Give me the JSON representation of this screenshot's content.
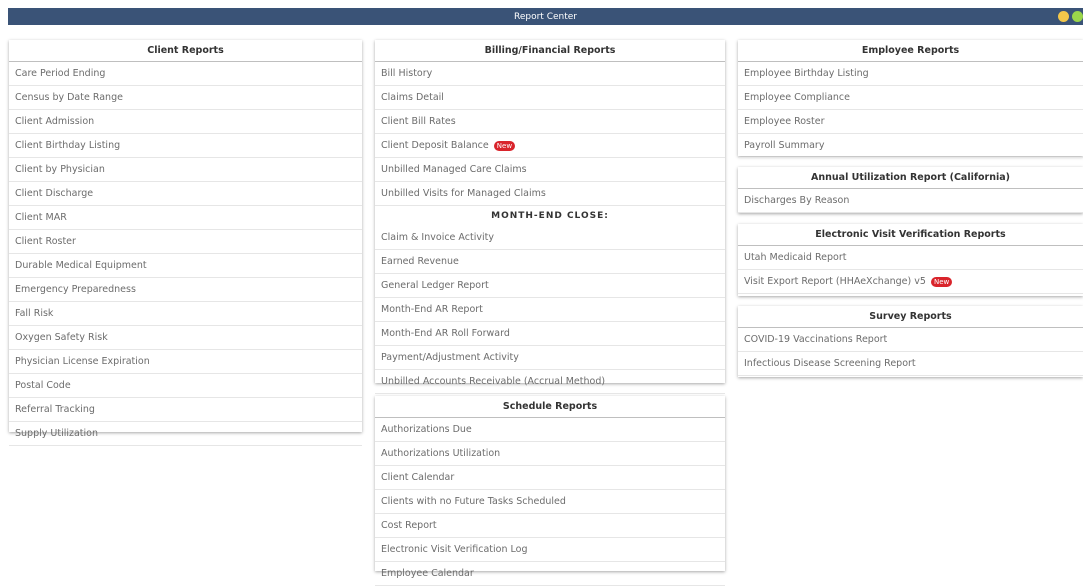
{
  "window": {
    "title": "Report Center"
  },
  "client_reports": {
    "title": "Client Reports",
    "items": [
      "Care Period Ending",
      "Census by Date Range",
      "Client Admission",
      "Client Birthday Listing",
      "Client by Physician",
      "Client Discharge",
      "Client MAR",
      "Client Roster",
      "Durable Medical Equipment",
      "Emergency Preparedness",
      "Fall Risk",
      "Oxygen Safety Risk",
      "Physician License Expiration",
      "Postal Code",
      "Referral Tracking",
      "Supply Utilization"
    ]
  },
  "billing_reports": {
    "title": "Billing/Financial Reports",
    "items": [
      {
        "label": "Bill History"
      },
      {
        "label": "Claims Detail"
      },
      {
        "label": "Client Bill Rates"
      },
      {
        "label": "Client Deposit Balance",
        "badge": "New"
      },
      {
        "label": "Unbilled Managed Care Claims"
      },
      {
        "label": "Unbilled Visits for Managed Claims"
      }
    ],
    "subheading": "MONTH-END CLOSE:",
    "month_end_items": [
      "Claim & Invoice Activity",
      "Earned Revenue",
      "General Ledger Report",
      "Month-End AR Report",
      "Month-End AR Roll Forward",
      "Payment/Adjustment Activity",
      "Unbilled Accounts Receivable (Accrual Method)"
    ]
  },
  "schedule_reports": {
    "title": "Schedule Reports",
    "items": [
      "Authorizations Due",
      "Authorizations Utilization",
      "Client Calendar",
      "Clients with no Future Tasks Scheduled",
      "Cost Report",
      "Electronic Visit Verification Log",
      "Employee Calendar"
    ]
  },
  "employee_reports": {
    "title": "Employee Reports",
    "items": [
      "Employee Birthday Listing",
      "Employee Compliance",
      "Employee Roster",
      "Payroll Summary"
    ]
  },
  "annual_utilization": {
    "title": "Annual Utilization Report (California)",
    "items": [
      "Discharges By Reason"
    ]
  },
  "evv_reports": {
    "title": "Electronic Visit Verification Reports",
    "items": [
      {
        "label": "Utah Medicaid Report"
      },
      {
        "label": "Visit Export Report (HHAeXchange) v5",
        "badge": "New"
      }
    ]
  },
  "survey_reports": {
    "title": "Survey Reports",
    "items": [
      "COVID-19 Vaccinations Report",
      "Infectious Disease Screening Report"
    ]
  },
  "colors": {
    "titlebar": "#3a5377",
    "badge": "#d9242b",
    "item_text": "#6c6c6c"
  }
}
